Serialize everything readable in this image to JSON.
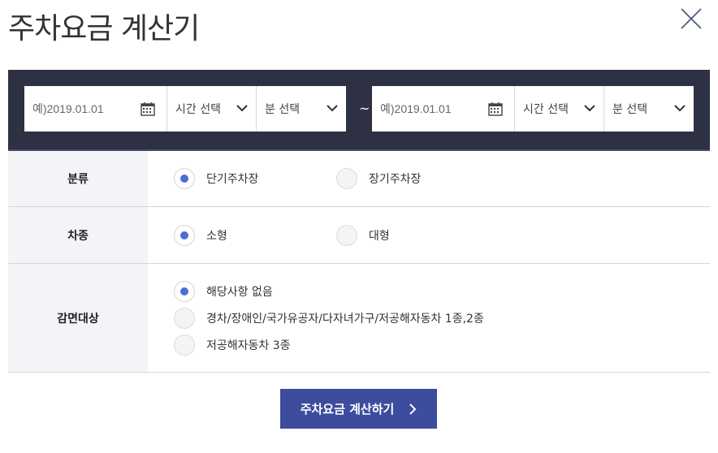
{
  "dialog": {
    "title": "주차요금 계산기"
  },
  "date_range": {
    "separator": "~",
    "start": {
      "date_placeholder": "예)2019.01.01",
      "hour_select": "시간 선택",
      "minute_select": "분 선택"
    },
    "end": {
      "date_placeholder": "예)2019.01.01",
      "hour_select": "시간 선택",
      "minute_select": "분 선택"
    }
  },
  "form": {
    "category": {
      "label": "분류",
      "options": [
        "단기주차장",
        "장기주차장"
      ],
      "selected": 0
    },
    "vehicle": {
      "label": "차종",
      "options": [
        "소형",
        "대형"
      ],
      "selected": 0
    },
    "discount": {
      "label": "감면대상",
      "options": [
        "해당사항 없음",
        "경차/장애인/국가유공자/다자녀가구/저공해자동차 1종,2종",
        "저공해자동차 3종"
      ],
      "selected": 0
    }
  },
  "submit_label": "주차요금 계산하기",
  "colors": {
    "date_bar_bg": "#2e3144",
    "radio_selected": "#4a6ed4",
    "button_bg": "#3e4c9e",
    "label_bg": "#f3f4f8"
  },
  "icons": {
    "close": "close-icon",
    "calendar": "calendar-icon",
    "dropdown": "chevron-down-icon",
    "submit_arrow": "chevron-right-icon"
  }
}
